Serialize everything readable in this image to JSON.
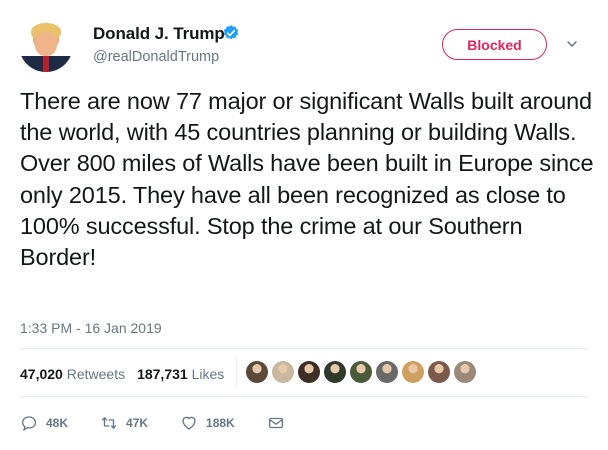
{
  "user": {
    "name": "Donald J. Trump",
    "handle": "@realDonaldTrump",
    "avatar_icon": "profile-photo",
    "verified_icon": "verified-badge-icon",
    "verified_color": "#1da1f2"
  },
  "header": {
    "blocked_label": "Blocked",
    "blocked_color": "#e0245e",
    "menu_icon": "chevron-down-icon"
  },
  "tweet": {
    "text": "There are now 77 major or significant Walls built around the world, with 45 countries planning or building Walls. Over 800 miles of Walls have been built in Europe since only 2015. They have all been recognized as close to 100% successful. Stop the crime at our Southern Border!",
    "timestamp": "1:33 PM - 16 Jan 2019"
  },
  "stats": {
    "retweets_count": "47,020",
    "retweets_label": "Retweets",
    "likes_count": "187,731",
    "likes_label": "Likes"
  },
  "likers": {
    "count": 9,
    "avatar_colors": [
      "#5a4a3a",
      "#c9b8a0",
      "#3b2f26",
      "#2e3a2a",
      "#4a5a3a",
      "#6a6a6a",
      "#d0a060",
      "#7a5a4a",
      "#9a8a7a"
    ]
  },
  "actions": {
    "reply_count": "48K",
    "retweet_count": "47K",
    "like_count": "188K",
    "reply_icon": "reply-icon",
    "retweet_icon": "retweet-icon",
    "like_icon": "heart-icon",
    "dm_icon": "envelope-icon"
  }
}
